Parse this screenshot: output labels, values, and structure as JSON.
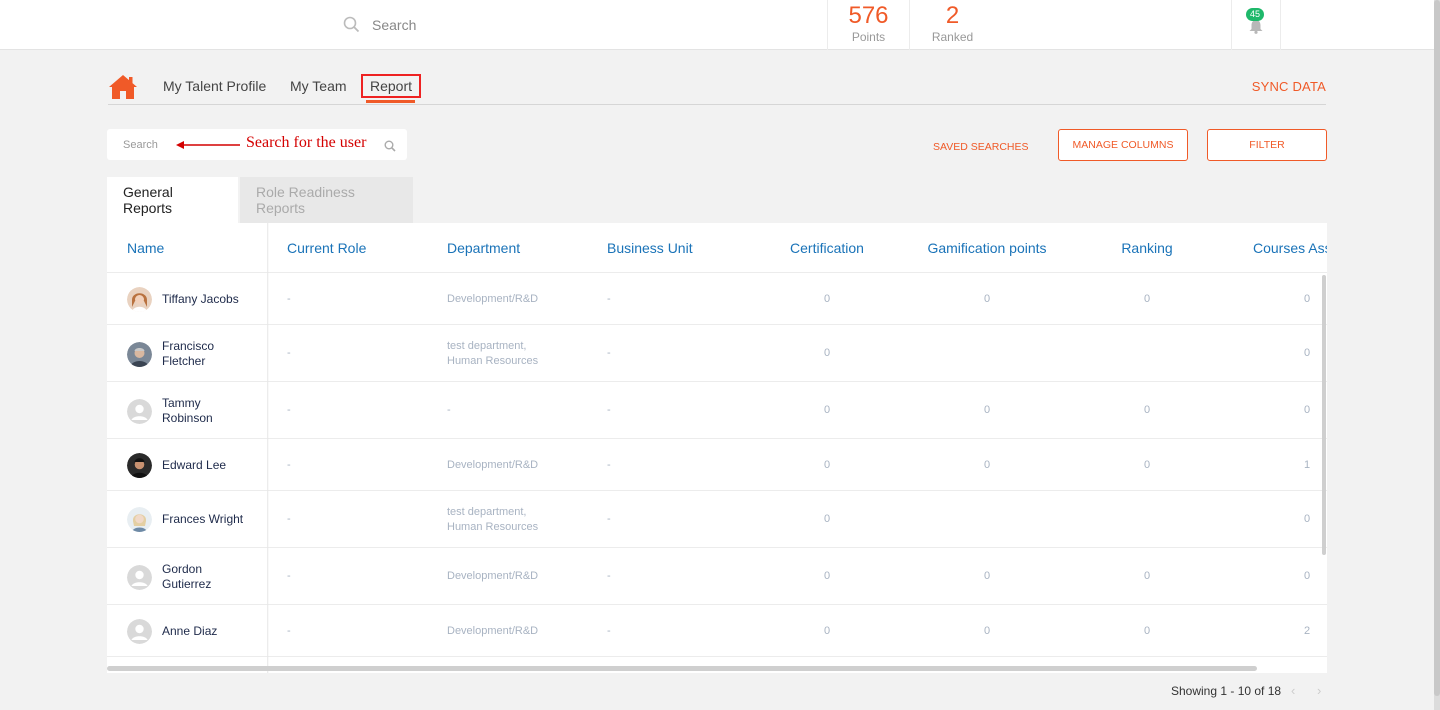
{
  "topbar": {
    "search_placeholder": "Search",
    "points_value": "576",
    "points_label": "Points",
    "ranked_value": "2",
    "ranked_label": "Ranked",
    "notification_count": "45"
  },
  "nav": {
    "items": [
      "My Talent Profile",
      "My Team",
      "Report"
    ],
    "active": "Report",
    "sync_label": "SYNC DATA"
  },
  "toolbar": {
    "user_search_placeholder": "Search",
    "annotation": "Search for the user",
    "saved_searches": "SAVED SEARCHES",
    "manage_columns": "MANAGE COLUMNS",
    "filter": "FILTER"
  },
  "tabs": [
    "General Reports",
    "Role Readiness Reports"
  ],
  "table": {
    "columns": [
      "Name",
      "Current Role",
      "Department",
      "Business Unit",
      "Certification",
      "Gamification points",
      "Ranking",
      "Courses Ass"
    ],
    "rows": [
      {
        "name": [
          "Tiffany Jacobs"
        ],
        "role": "-",
        "dept": [
          "Development/R&D"
        ],
        "bu": "-",
        "cert": "0",
        "gam": "0",
        "rank": "0",
        "courses": "0",
        "avatar": "photo-female-1"
      },
      {
        "name": [
          "Francisco",
          "Fletcher"
        ],
        "role": "-",
        "dept": [
          "test department,",
          "Human Resources"
        ],
        "bu": "-",
        "cert": "0",
        "gam": "",
        "rank": "",
        "courses": "0",
        "avatar": "photo-male-1"
      },
      {
        "name": [
          "Tammy",
          "Robinson"
        ],
        "role": "-",
        "dept": [
          "-"
        ],
        "bu": "-",
        "cert": "0",
        "gam": "0",
        "rank": "0",
        "courses": "0",
        "avatar": "placeholder"
      },
      {
        "name": [
          "Edward Lee"
        ],
        "role": "-",
        "dept": [
          "Development/R&D"
        ],
        "bu": "-",
        "cert": "0",
        "gam": "0",
        "rank": "0",
        "courses": "1",
        "avatar": "photo-male-2"
      },
      {
        "name": [
          "Frances Wright"
        ],
        "role": "-",
        "dept": [
          "test department,",
          "Human Resources"
        ],
        "bu": "-",
        "cert": "0",
        "gam": "",
        "rank": "",
        "courses": "0",
        "avatar": "photo-female-2"
      },
      {
        "name": [
          "Gordon",
          "Gutierrez"
        ],
        "role": "-",
        "dept": [
          "Development/R&D"
        ],
        "bu": "-",
        "cert": "0",
        "gam": "0",
        "rank": "0",
        "courses": "0",
        "avatar": "placeholder"
      },
      {
        "name": [
          "Anne Diaz"
        ],
        "role": "-",
        "dept": [
          "Development/R&D"
        ],
        "bu": "-",
        "cert": "0",
        "gam": "0",
        "rank": "0",
        "courses": "2",
        "avatar": "placeholder"
      }
    ]
  },
  "pagination": {
    "text": "Showing 1 - 10 of 18"
  },
  "colors": {
    "accent": "#f05a28",
    "link_blue": "#1a73b8",
    "badge_green": "#1eb86a",
    "annotation_red": "#d40000"
  },
  "icons": [
    "search-icon",
    "home-icon",
    "bell-icon",
    "chevron-left-icon",
    "chevron-right-icon",
    "arrow-left-icon"
  ]
}
